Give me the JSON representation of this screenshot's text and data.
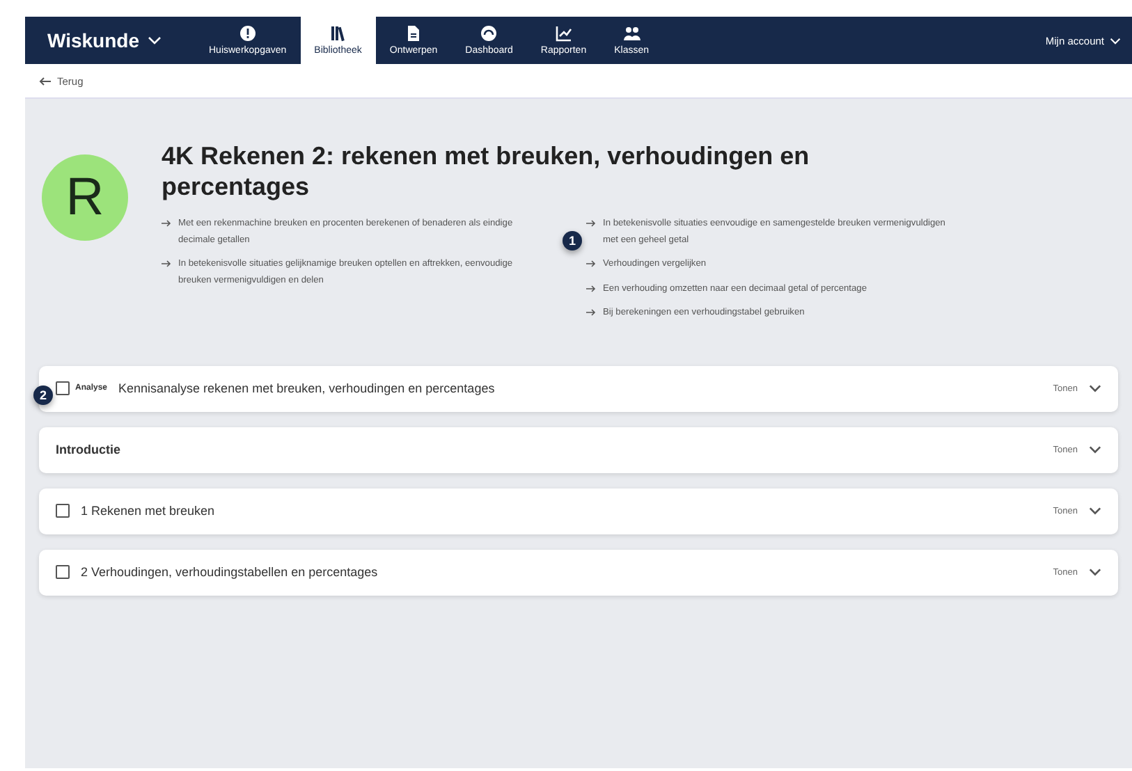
{
  "nav": {
    "brand": "Wiskunde",
    "tabs": [
      {
        "label": "Huiswerkopgaven",
        "selected": false
      },
      {
        "label": "Bibliotheek",
        "selected": true
      },
      {
        "label": "Ontwerpen",
        "selected": false
      },
      {
        "label": "Dashboard",
        "selected": false
      },
      {
        "label": "Rapporten",
        "selected": false
      },
      {
        "label": "Klassen",
        "selected": false
      }
    ],
    "account": "Mijn account"
  },
  "back": "Terug",
  "course": {
    "avatar": "R",
    "title": "4K Rekenen 2: rekenen met breuken, verhoudingen en percentages",
    "goals_left": [
      "Met een rekenmachine breuken en procenten berekenen of benaderen als eindige decimale getallen",
      "In betekenisvolle situaties gelijknamige breuken optellen en aftrekken, eenvoudige breuken vermenigvuldigen en delen"
    ],
    "goals_right": [
      "In betekenisvolle situaties eenvoudige en samengestelde breuken vermenigvuldigen met een geheel getal",
      "Verhoudingen vergelijken",
      "Een verhouding omzetten naar een decimaal getal of percentage",
      "Bij berekeningen een verhoudingstabel gebruiken"
    ]
  },
  "sections": [
    {
      "kind": "analysis",
      "tag": "Analyse",
      "title": "Kennisanalyse rekenen met breuken, verhoudingen en percentages",
      "checked": false,
      "action": "Tonen"
    },
    {
      "kind": "plain",
      "title": "Introductie",
      "action": "Tonen"
    },
    {
      "kind": "checkbox",
      "title": "1 Rekenen met breuken",
      "checked": false,
      "action": "Tonen"
    },
    {
      "kind": "checkbox",
      "title": "2 Verhoudingen, verhoudingstabellen en percentages",
      "checked": false,
      "action": "Tonen"
    }
  ],
  "markers": [
    "1",
    "2"
  ]
}
